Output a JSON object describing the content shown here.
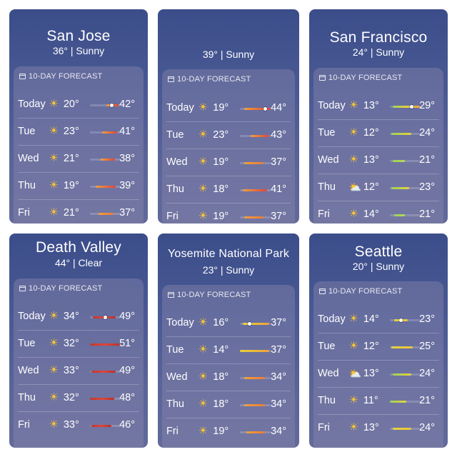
{
  "colors": {
    "sun": "#f7c533",
    "hot": "#e0453a",
    "warm": "#f0a03c",
    "mild": "#e6d23c",
    "cool": "#9bd35a"
  },
  "panels": [
    {
      "city": "San Jose",
      "summary": "36° | Sunny",
      "forecast_label": "10-DAY FORECAST",
      "rows": [
        {
          "day": "Today",
          "icon": "sun-icon",
          "lo": "20°",
          "hi": "42°",
          "bar_start": 0.55,
          "bar_end": 0.95,
          "current": 0.72,
          "grad": "warm-hot"
        },
        {
          "day": "Tue",
          "icon": "sun-icon",
          "lo": "23°",
          "hi": "41°",
          "bar_start": 0.4,
          "bar_end": 0.9,
          "grad": "warm-hot"
        },
        {
          "day": "Wed",
          "icon": "sun-icon",
          "lo": "21°",
          "hi": "38°",
          "bar_start": 0.35,
          "bar_end": 0.82,
          "grad": "warm-hot"
        },
        {
          "day": "Thu",
          "icon": "sun-icon",
          "lo": "19°",
          "hi": "39°",
          "bar_start": 0.2,
          "bar_end": 0.85,
          "grad": "warm-hot"
        },
        {
          "day": "Fri",
          "icon": "sun-icon",
          "lo": "21°",
          "hi": "37°",
          "bar_start": 0.3,
          "bar_end": 0.78,
          "grad": "warm"
        }
      ]
    },
    {
      "city": "",
      "summary": "39° | Sunny",
      "forecast_label": "10-DAY FORECAST",
      "rows": [
        {
          "day": "Today",
          "icon": "sun-icon",
          "lo": "19°",
          "hi": "44°",
          "bar_start": 0.15,
          "bar_end": 0.98,
          "current": 0.8,
          "grad": "warm-hot"
        },
        {
          "day": "Tue",
          "icon": "sun-icon",
          "lo": "23°",
          "hi": "43°",
          "bar_start": 0.35,
          "bar_end": 0.95,
          "grad": "warm-hot"
        },
        {
          "day": "Wed",
          "icon": "sun-icon",
          "lo": "19°",
          "hi": "37°",
          "bar_start": 0.15,
          "bar_end": 0.75,
          "grad": "warm"
        },
        {
          "day": "Thu",
          "icon": "sun-icon",
          "lo": "18°",
          "hi": "41°",
          "bar_start": 0.1,
          "bar_end": 0.88,
          "grad": "warm-hot"
        },
        {
          "day": "Fri",
          "icon": "sun-icon",
          "lo": "19°",
          "hi": "37°",
          "bar_start": 0.15,
          "bar_end": 0.75,
          "grad": "warm"
        }
      ]
    },
    {
      "city": "San Francisco",
      "summary": "24° | Sunny",
      "forecast_label": "10-DAY FORECAST",
      "rows": [
        {
          "day": "Today",
          "icon": "sun-icon",
          "lo": "13°",
          "hi": "29°",
          "bar_start": 0.1,
          "bar_end": 0.98,
          "current": 0.7,
          "grad": "cool-warm"
        },
        {
          "day": "Tue",
          "icon": "sun-icon",
          "lo": "12°",
          "hi": "24°",
          "bar_start": 0.05,
          "bar_end": 0.7,
          "grad": "cool-mild"
        },
        {
          "day": "Wed",
          "icon": "sun-icon",
          "lo": "13°",
          "hi": "21°",
          "bar_start": 0.1,
          "bar_end": 0.5,
          "grad": "cool"
        },
        {
          "day": "Thu",
          "icon": "cloud-sun-icon",
          "lo": "12°",
          "hi": "23°",
          "bar_start": 0.05,
          "bar_end": 0.65,
          "grad": "cool-mild"
        },
        {
          "day": "Fri",
          "icon": "sun-icon",
          "lo": "14°",
          "hi": "21°",
          "bar_start": 0.15,
          "bar_end": 0.5,
          "grad": "cool"
        }
      ]
    },
    {
      "city": "Death Valley",
      "summary": "44° | Clear",
      "forecast_label": "10-DAY FORECAST",
      "rows": [
        {
          "day": "Today",
          "icon": "sun-icon",
          "lo": "34°",
          "hi": "49°",
          "bar_start": 0.1,
          "bar_end": 0.85,
          "current": 0.5,
          "grad": "deep"
        },
        {
          "day": "Tue",
          "icon": "sun-icon",
          "lo": "32°",
          "hi": "51°",
          "bar_start": 0.0,
          "bar_end": 0.98,
          "grad": "deep"
        },
        {
          "day": "Wed",
          "icon": "sun-icon",
          "lo": "33°",
          "hi": "49°",
          "bar_start": 0.05,
          "bar_end": 0.85,
          "grad": "deep"
        },
        {
          "day": "Thu",
          "icon": "sun-icon",
          "lo": "32°",
          "hi": "48°",
          "bar_start": 0.0,
          "bar_end": 0.8,
          "grad": "deep"
        },
        {
          "day": "Fri",
          "icon": "sun-icon",
          "lo": "33°",
          "hi": "46°",
          "bar_start": 0.05,
          "bar_end": 0.7,
          "grad": "deep"
        }
      ]
    },
    {
      "city": "Yosemite National Park",
      "summary": "23° | Sunny",
      "forecast_label": "10-DAY FORECAST",
      "rows": [
        {
          "day": "Today",
          "icon": "sun-icon",
          "lo": "16°",
          "hi": "37°",
          "bar_start": 0.1,
          "bar_end": 0.95,
          "current": 0.3,
          "grad": "mild-warm"
        },
        {
          "day": "Tue",
          "icon": "sun-icon",
          "lo": "14°",
          "hi": "37°",
          "bar_start": 0.0,
          "bar_end": 0.95,
          "grad": "mild-warm"
        },
        {
          "day": "Wed",
          "icon": "sun-icon",
          "lo": "18°",
          "hi": "34°",
          "bar_start": 0.15,
          "bar_end": 0.8,
          "grad": "warm"
        },
        {
          "day": "Thu",
          "icon": "sun-icon",
          "lo": "18°",
          "hi": "34°",
          "bar_start": 0.15,
          "bar_end": 0.8,
          "grad": "warm"
        },
        {
          "day": "Fri",
          "icon": "sun-icon",
          "lo": "19°",
          "hi": "34°",
          "bar_start": 0.2,
          "bar_end": 0.8,
          "grad": "warm"
        }
      ]
    },
    {
      "city": "Seattle",
      "summary": "20° | Sunny",
      "forecast_label": "10-DAY FORECAST",
      "rows": [
        {
          "day": "Today",
          "icon": "sun-icon",
          "lo": "14°",
          "hi": "23°",
          "bar_start": 0.15,
          "bar_end": 0.6,
          "current": 0.35,
          "grad": "mild"
        },
        {
          "day": "Tue",
          "icon": "sun-icon",
          "lo": "12°",
          "hi": "25°",
          "bar_start": 0.05,
          "bar_end": 0.75,
          "grad": "mild"
        },
        {
          "day": "Wed",
          "icon": "cloud-sun-icon",
          "lo": "13°",
          "hi": "24°",
          "bar_start": 0.1,
          "bar_end": 0.7,
          "grad": "cool-mild"
        },
        {
          "day": "Thu",
          "icon": "sun-icon",
          "lo": "11°",
          "hi": "21°",
          "bar_start": 0.0,
          "bar_end": 0.55,
          "grad": "cool-mild"
        },
        {
          "day": "Fri",
          "icon": "sun-icon",
          "lo": "13°",
          "hi": "24°",
          "bar_start": 0.1,
          "bar_end": 0.7,
          "grad": "mild"
        }
      ]
    }
  ]
}
